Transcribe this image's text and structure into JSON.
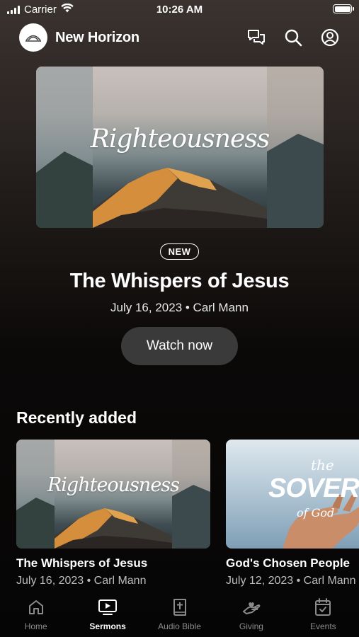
{
  "status_bar": {
    "carrier": "Carrier",
    "time": "10:26 AM"
  },
  "header": {
    "app_name": "New Horizon",
    "icons": [
      "chat-icon",
      "search-icon",
      "profile-icon"
    ]
  },
  "hero": {
    "art_title": "Righteousness",
    "badge": "NEW",
    "title": "The Whispers of Jesus",
    "subtitle": "July 16, 2023 • Carl Mann",
    "button_label": "Watch now"
  },
  "recently_added": {
    "heading": "Recently added",
    "items": [
      {
        "art_title": "Righteousness",
        "title": "The Whispers of Jesus",
        "subtitle": "July 16, 2023 • Carl Mann"
      },
      {
        "art_the": "the",
        "art_word": "SOVEREIGNTY",
        "art_of": "of God",
        "title": "God's Chosen People",
        "subtitle": "July 12, 2023 • Carl Mann"
      }
    ]
  },
  "tab_bar": {
    "tabs": [
      {
        "label": "Home",
        "icon": "home-icon",
        "active": false
      },
      {
        "label": "Sermons",
        "icon": "tv-icon",
        "active": true
      },
      {
        "label": "Audio Bible",
        "icon": "bible-icon",
        "active": false
      },
      {
        "label": "Giving",
        "icon": "giving-icon",
        "active": false
      },
      {
        "label": "Events",
        "icon": "calendar-icon",
        "active": false
      }
    ]
  },
  "colors": {
    "background_top": "#3a3330",
    "background_bottom": "#060505",
    "button_bg": "#3a3a3a",
    "tab_inactive": "#8b8b8b"
  }
}
